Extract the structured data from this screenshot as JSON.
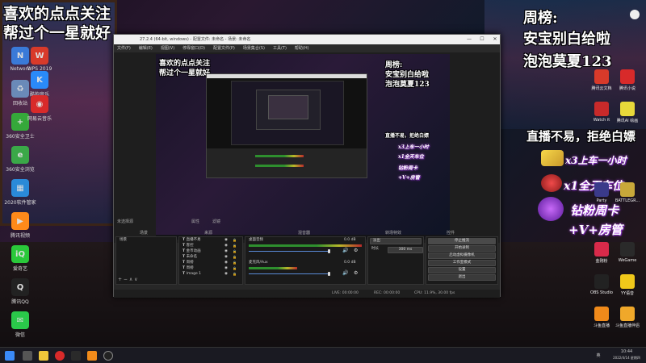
{
  "overlay": {
    "follow_line1": "喜欢的点点关注",
    "follow_line2": "帮过个一星就好",
    "week_title": "周榜:",
    "week_line1": "安宝别白给啦",
    "week_line2": "泡泡莫夏123",
    "slogan": "直播不易，拒绝白嫖",
    "gift1": "x3上车一小时",
    "gift2": "x1全天车位",
    "gift3": "钻粉周卡",
    "gift4": "+V+房管"
  },
  "desktop_icons_left": [
    {
      "label": "Network",
      "icon": "network-icon",
      "color": "#3a7ad8",
      "glyph": "N"
    },
    {
      "label": "回收站",
      "icon": "recycle-bin-icon",
      "color": "#6a8ab8",
      "glyph": "♻"
    },
    {
      "label": "360安全卫士",
      "icon": "360-safe-icon",
      "color": "#35a83a",
      "glyph": "+"
    },
    {
      "label": "360安全浏览",
      "icon": "360-browser-icon",
      "color": "#3aa848",
      "glyph": "e"
    },
    {
      "label": "2020软件管家",
      "icon": "software-manager-icon",
      "color": "#2a8ad8",
      "glyph": "▦"
    },
    {
      "label": "腾讯视频",
      "icon": "tencent-video-icon",
      "color": "#ff8a1a",
      "glyph": "▶"
    },
    {
      "label": "爱奇艺",
      "icon": "iqiyi-icon",
      "color": "#2ac83a",
      "glyph": "iQ"
    },
    {
      "label": "腾讯QQ",
      "icon": "qq-icon",
      "color": "#222222",
      "glyph": "Q"
    },
    {
      "label": "微信",
      "icon": "wechat-icon",
      "color": "#2ac84a",
      "glyph": "✉"
    }
  ],
  "desktop_icons_left2": [
    {
      "label": "WPS 2019",
      "icon": "wps-icon",
      "color": "#d83a2a",
      "glyph": "W"
    },
    {
      "label": "酷狗音乐",
      "icon": "kugou-icon",
      "color": "#2a8af8",
      "glyph": "K"
    },
    {
      "label": "网易云音乐",
      "icon": "netease-music-icon",
      "color": "#d82a2a",
      "glyph": "◉"
    }
  ],
  "desktop_icons_right": [
    {
      "label": "腾讯云文档",
      "icon": "tencent-docs-icon",
      "color": "#d83a2a"
    },
    {
      "label": "Watch it",
      "icon": "watch-icon",
      "color": "#c82a2a"
    },
    {
      "label": "Party",
      "icon": "party-icon",
      "color": "#3a3a8a"
    },
    {
      "label": "金刚粉",
      "icon": "fans-icon",
      "color": "#d82a4a"
    },
    {
      "label": "OBS Studio",
      "icon": "obs-studio-icon",
      "color": "#222222"
    },
    {
      "label": "斗鱼直播",
      "icon": "douyu-icon",
      "color": "#f08a1a"
    }
  ],
  "desktop_icons_right2": [
    {
      "label": "腾讯小说",
      "icon": "novel-icon",
      "color": "#d82a2a"
    },
    {
      "label": "腾讯AI 绘画",
      "icon": "ai-draw-icon",
      "color": "#e8d83a"
    },
    {
      "label": "BATTLEGR...",
      "icon": "pubg-icon",
      "color": "#c8a83a"
    },
    {
      "label": "WeGame",
      "icon": "wegame-icon",
      "color": "#2a2a2a"
    },
    {
      "label": "YY语音",
      "icon": "yy-icon",
      "color": "#f0c81a"
    },
    {
      "label": "斗鱼直播伴侣",
      "icon": "douyu-companion-icon",
      "color": "#f0a82a"
    }
  ],
  "obs": {
    "title": "27.2.4 (64-bit, windows) - 配置文件: 未命名 - 场景: 未命名",
    "menu": [
      "文件(F)",
      "编辑(E)",
      "视图(V)",
      "停靠窗口(D)",
      "配置文件(P)",
      "场景集合(S)",
      "工具(T)",
      "帮助(H)"
    ],
    "no_source_selected": "未选择源",
    "properties": "属性",
    "filters": "滤镜",
    "docks": {
      "scenes": "场景",
      "sources": "来源",
      "mixer": "混音器",
      "transitions": "转场特效",
      "controls": "控件"
    },
    "scenes": [
      "场景"
    ],
    "sources": [
      "直播不易",
      "客控",
      "金币动画",
      "未命名",
      "周榜",
      "周榜",
      "Image 1"
    ],
    "mixer": [
      {
        "name": "桌面音频",
        "db": "0.0 dB"
      },
      {
        "name": "麦克风/Aux",
        "db": "0.0 dB"
      }
    ],
    "transition_type": "淡出",
    "duration_label": "时长",
    "duration_value": "300 ms",
    "controls": [
      "停止推流",
      "开始录制",
      "启动虚拟摄像机",
      "工作室模式",
      "设置",
      "退出"
    ],
    "status": {
      "live": "LIVE: 00:00:00",
      "rec": "REC: 00:00:00",
      "cpu": "CPU: 11.9%, 30.00 fps"
    }
  },
  "taskbar": {
    "time": "10:44",
    "date": "2022/4/14 星期四",
    "lang": "英"
  }
}
